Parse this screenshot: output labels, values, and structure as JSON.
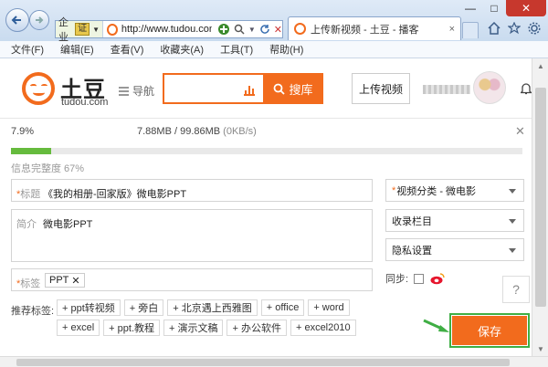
{
  "browser": {
    "address": {
      "zone": "企业",
      "cert": "证",
      "url": "http://www.tudou.com/i"
    },
    "tab_title": "上传新视频 - 土豆 - 播客",
    "tab_close": "×",
    "win_min": "—",
    "win_max": "□",
    "win_close": "✕"
  },
  "menu": {
    "items": [
      "文件(F)",
      "编辑(E)",
      "查看(V)",
      "收藏夹(A)",
      "工具(T)",
      "帮助(H)"
    ]
  },
  "header": {
    "logo_text": "土豆",
    "logo_sub": "tudou.com",
    "guide": "导航",
    "search_placeholder": "",
    "search_button": "搜库",
    "upload_button": "上传视频"
  },
  "upload": {
    "percent_text": "7.9%",
    "size_text": "7.88MB / 99.86MB",
    "speed_text": "(0KB/s)",
    "close": "✕",
    "progress": 0.079,
    "info_score": "信息完整度 67%"
  },
  "form": {
    "title_label": "标题",
    "title_value": "《我的相册-回家版》微电影PPT",
    "desc_label": "简介",
    "desc_value": "微电影PPT",
    "tags_label": "标签",
    "tag_chip": "PPT",
    "tag_remove": "✕",
    "category": "视频分类 - 微电影",
    "column": "收录栏目",
    "privacy": "隐私设置",
    "sync_label": "同步:",
    "rec_label": "推荐标签:",
    "rec_tags": [
      "+ ppt转视频",
      "+ 旁白",
      "+ 北京遇上西雅图",
      "+ office",
      "+ word",
      "+ excel",
      "+ ppt.教程",
      "+ 演示文稿",
      "+ 办公软件",
      "+ excel2010"
    ],
    "help": "?",
    "save": "保存"
  },
  "colors": {
    "brand": "#f26b1d",
    "progress": "#66bb3d",
    "highlight": "#3fae44"
  }
}
